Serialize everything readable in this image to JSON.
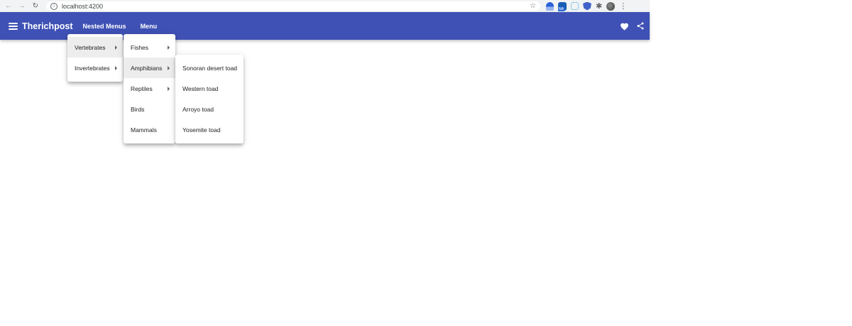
{
  "browser": {
    "url": "localhost:4200",
    "back_icon": "arrow-left",
    "forward_icon": "arrow-right",
    "reload_icon": "reload",
    "info_icon": "info",
    "bookmark_icon": "star"
  },
  "toolbar": {
    "color": "#3f51b5",
    "brand": "Therichpost",
    "nested_menus_label": "Nested Menus",
    "menu_label": "Menu"
  },
  "menus": {
    "level1": [
      {
        "label": "Vertebrates",
        "has_submenu": true,
        "active": true
      },
      {
        "label": "Invertebrates",
        "has_submenu": true,
        "active": false
      }
    ],
    "level2": [
      {
        "label": "Fishes",
        "has_submenu": true,
        "active": false
      },
      {
        "label": "Amphibians",
        "has_submenu": true,
        "active": true
      },
      {
        "label": "Reptiles",
        "has_submenu": true,
        "active": false
      },
      {
        "label": "Birds",
        "has_submenu": false,
        "active": false
      },
      {
        "label": "Mammals",
        "has_submenu": false,
        "active": false
      }
    ],
    "level3": [
      {
        "label": "Sonoran desert toad"
      },
      {
        "label": "Western toad"
      },
      {
        "label": "Arroyo toad"
      },
      {
        "label": "Yosemite toad"
      }
    ]
  }
}
